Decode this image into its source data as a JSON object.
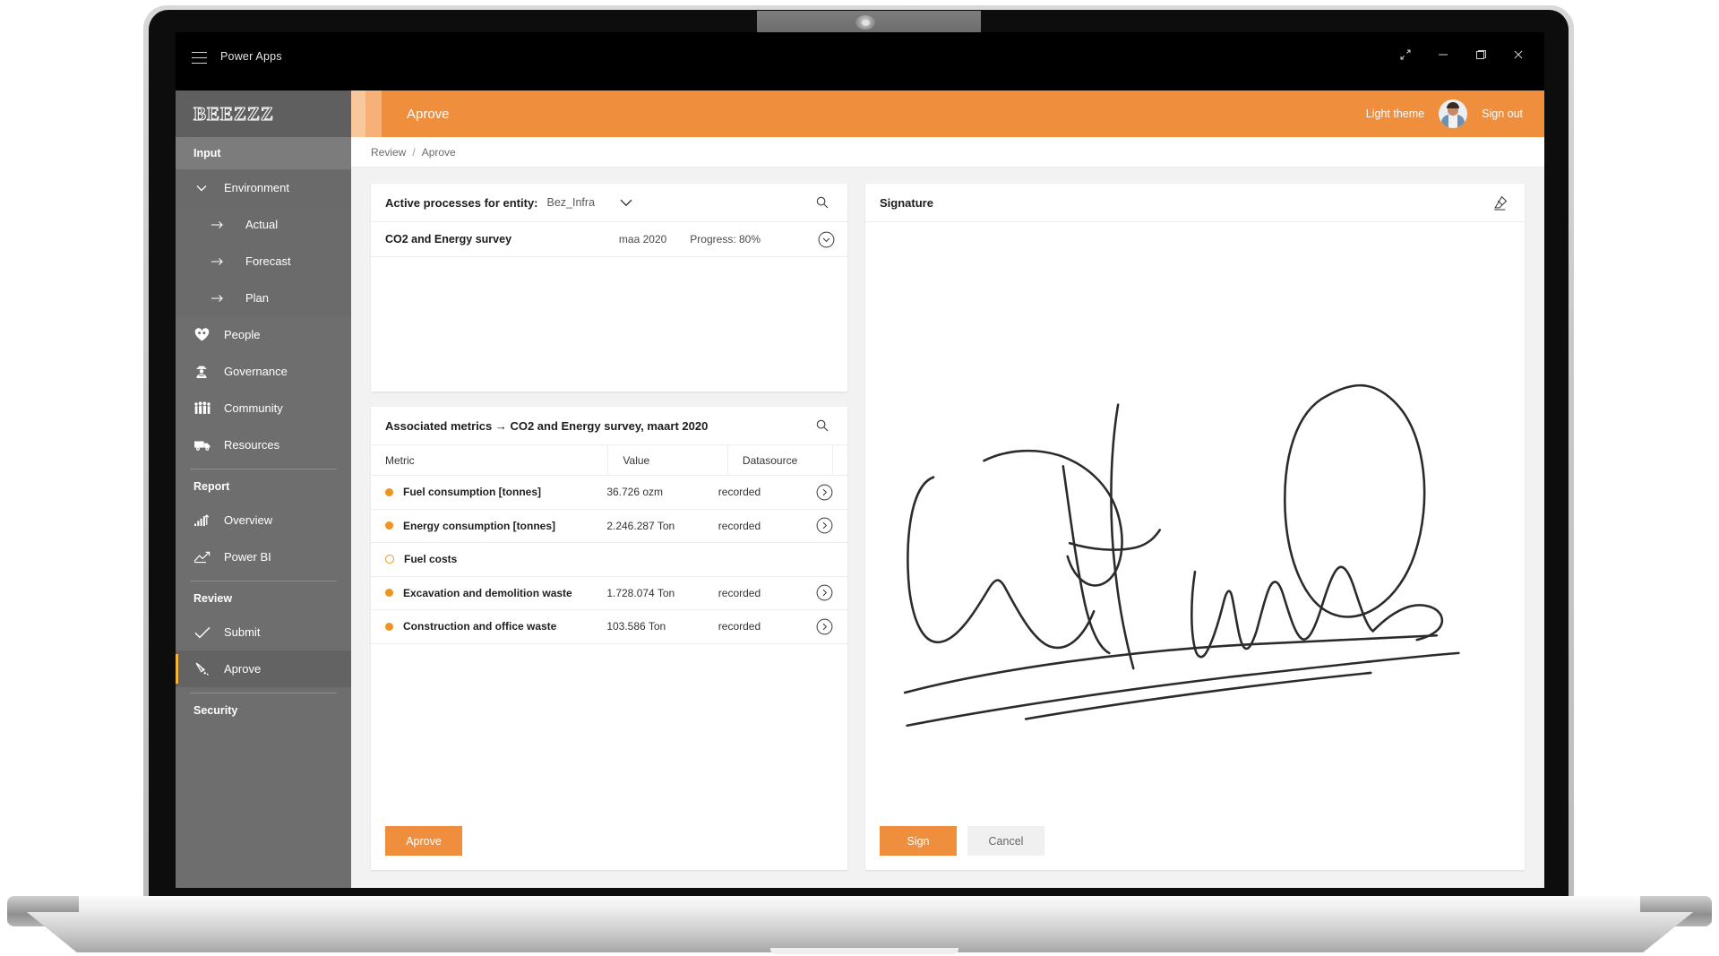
{
  "window": {
    "app_name": "Power Apps",
    "controls": [
      "expand-icon",
      "minimize-icon",
      "restore-icon",
      "close-icon"
    ]
  },
  "sidebar": {
    "brand": "BEEZZZ",
    "sections": [
      {
        "heading": "Input",
        "items": [
          {
            "label": "Environment",
            "icon": "chevron-down-icon",
            "level": "group"
          },
          {
            "label": "Actual",
            "icon": "arrow-right-icon",
            "level": "sub"
          },
          {
            "label": "Forecast",
            "icon": "arrow-right-icon",
            "level": "sub"
          },
          {
            "label": "Plan",
            "icon": "arrow-right-icon",
            "level": "sub"
          },
          {
            "label": "People",
            "icon": "heart-people-icon",
            "level": "item"
          },
          {
            "label": "Governance",
            "icon": "officer-icon",
            "level": "item"
          },
          {
            "label": "Community",
            "icon": "group-people-icon",
            "level": "item"
          },
          {
            "label": "Resources",
            "icon": "truck-icon",
            "level": "item"
          }
        ]
      },
      {
        "heading": "Report",
        "items": [
          {
            "label": "Overview",
            "icon": "bar-chart-icon",
            "level": "item"
          },
          {
            "label": "Power BI",
            "icon": "line-chart-icon",
            "level": "item"
          }
        ]
      },
      {
        "heading": "Review",
        "items": [
          {
            "label": "Submit",
            "icon": "check-icon",
            "level": "item"
          },
          {
            "label": "Aprove",
            "icon": "signature-pen-icon",
            "level": "item",
            "selected": true
          }
        ]
      },
      {
        "heading": "Security",
        "items": []
      }
    ]
  },
  "appbar": {
    "title": "Aprove",
    "theme_toggle": "Light theme",
    "sign_out": "Sign out",
    "accent": "#ef8e3d"
  },
  "breadcrumb": {
    "parent": "Review",
    "separator": "/",
    "current": "Aprove"
  },
  "processes_card": {
    "title": "Active processes for entity:",
    "entity": "Bez_Infra",
    "dropdown_icon": "chevron-down-icon",
    "search_icon": "search-icon",
    "rows": [
      {
        "name": "CO2 and Energy survey",
        "date": "maa 2020",
        "progress": "Progress: 80%",
        "expand_icon": "chevron-down-circle-icon"
      }
    ]
  },
  "metrics_card": {
    "title": "Associated metrics → CO2 and Energy survey, maart 2020",
    "search_icon": "search-icon",
    "columns": [
      "Metric",
      "Value",
      "Datasource",
      ""
    ],
    "rows": [
      {
        "status": "filled",
        "metric": "Fuel consumption [tonnes]",
        "value": "36.726 ozm",
        "datasource": "recorded",
        "action_icon": "chevron-right-circle-icon"
      },
      {
        "status": "filled",
        "metric": "Energy consumption [tonnes]",
        "value": "2.246.287 Ton",
        "datasource": "recorded",
        "action_icon": "chevron-right-circle-icon"
      },
      {
        "status": "hollow",
        "metric": "Fuel costs",
        "value": "",
        "datasource": "",
        "action_icon": ""
      },
      {
        "status": "filled",
        "metric": "Excavation and demolition waste",
        "value": "1.728.074 Ton",
        "datasource": "recorded",
        "action_icon": "chevron-right-circle-icon"
      },
      {
        "status": "filled",
        "metric": "Construction and office waste",
        "value": "103.586 Ton",
        "datasource": "recorded",
        "action_icon": "chevron-right-circle-icon"
      }
    ],
    "approve_button": "Aprove",
    "dot_color": "#f2921f"
  },
  "signature_card": {
    "title": "Signature",
    "erase_icon": "eraser-icon",
    "sign_button": "Sign",
    "cancel_button": "Cancel"
  }
}
